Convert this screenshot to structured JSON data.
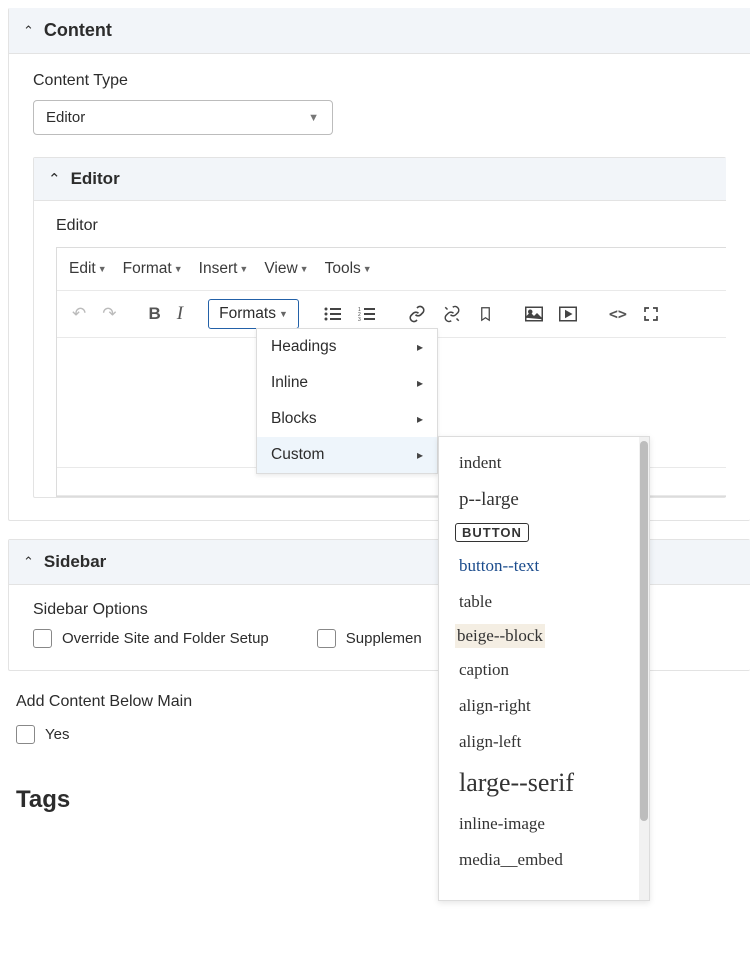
{
  "content": {
    "title": "Content",
    "contentTypeLabel": "Content Type",
    "contentTypeValue": "Editor"
  },
  "editor": {
    "panelTitle": "Editor",
    "label": "Editor",
    "menubar": [
      "Edit",
      "Format",
      "Insert",
      "View",
      "Tools"
    ],
    "formatsLabel": "Formats",
    "ddItems": [
      "Headings",
      "Inline",
      "Blocks",
      "Custom"
    ],
    "customItems": [
      "indent",
      "p--large",
      "BUTTON",
      "button--text",
      "table",
      "beige--block",
      "caption",
      "align-right",
      "align-left",
      "large--serif",
      "inline-image",
      "media__embed"
    ]
  },
  "sidebar": {
    "title": "Sidebar",
    "optionsLabel": "Sidebar Options",
    "chk1": "Override Site and Folder Setup",
    "chk2": "Supplemen"
  },
  "belowMain": {
    "label": "Add Content Below Main",
    "yes": "Yes"
  },
  "tags": {
    "title": "Tags"
  }
}
